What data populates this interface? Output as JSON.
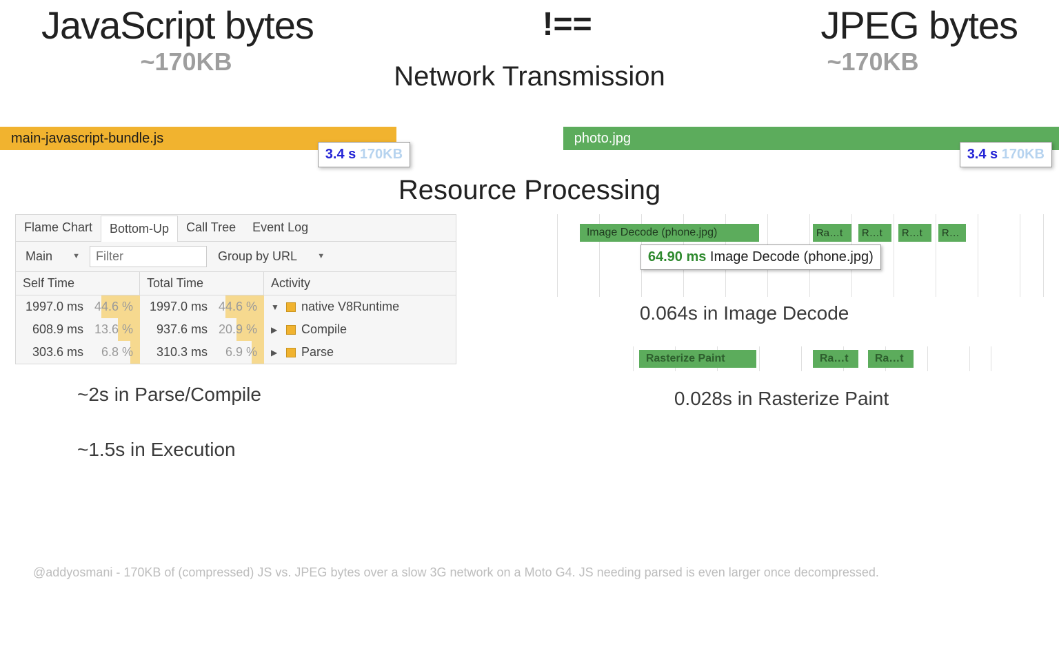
{
  "title": {
    "js": "JavaScript bytes",
    "neq": "!==",
    "jpeg": "JPEG bytes",
    "js_size": "~170KB",
    "jpeg_size": "~170KB"
  },
  "sections": {
    "network": "Network Transmission",
    "processing": "Resource Processing"
  },
  "network": {
    "js_file": "main-javascript-bundle.js",
    "jpeg_file": "photo.jpg",
    "time": "3.4 s",
    "size": "170KB"
  },
  "devtools": {
    "tabs": [
      "Flame Chart",
      "Bottom-Up",
      "Call Tree",
      "Event Log"
    ],
    "active_tab": "Bottom-Up",
    "thread": "Main",
    "filter_placeholder": "Filter",
    "group": "Group by URL",
    "headers": {
      "self": "Self Time",
      "total": "Total Time",
      "activity": "Activity"
    },
    "rows": [
      {
        "self_ms": "1997.0 ms",
        "self_pct": "44.6 %",
        "self_w": 56,
        "total_ms": "1997.0 ms",
        "total_pct": "44.6 %",
        "total_w": 56,
        "chev": "▼",
        "act": "native V8Runtime"
      },
      {
        "self_ms": "608.9 ms",
        "self_pct": "13.6 %",
        "self_w": 32,
        "total_ms": "937.6 ms",
        "total_pct": "20.9 %",
        "total_w": 40,
        "chev": "▶",
        "act": "Compile"
      },
      {
        "self_ms": "303.6 ms",
        "self_pct": "6.8 %",
        "self_w": 14,
        "total_ms": "310.3 ms",
        "total_pct": "6.9 %",
        "total_w": 18,
        "chev": "▶",
        "act": "Parse"
      }
    ]
  },
  "image_proc": {
    "main": "Image Decode (phone.jpg)",
    "slices": [
      "Ra…t",
      "R…t",
      "R…t",
      "R…"
    ],
    "tip_ms": "64.90 ms",
    "tip_label": "Image Decode (phone.jpg)"
  },
  "raster": {
    "main": "Rasterize Paint",
    "slices": [
      "Ra…t",
      "Ra…t"
    ]
  },
  "summaries": {
    "parse": "~2s in Parse/Compile",
    "exec": "~1.5s in Execution",
    "decode": "0.064s in Image Decode",
    "paint": "0.028s in Rasterize Paint"
  },
  "caption": "@addyosmani - 170KB of (compressed) JS vs. JPEG bytes over a slow 3G network on a Moto G4. JS needing parsed is even larger once decompressed."
}
